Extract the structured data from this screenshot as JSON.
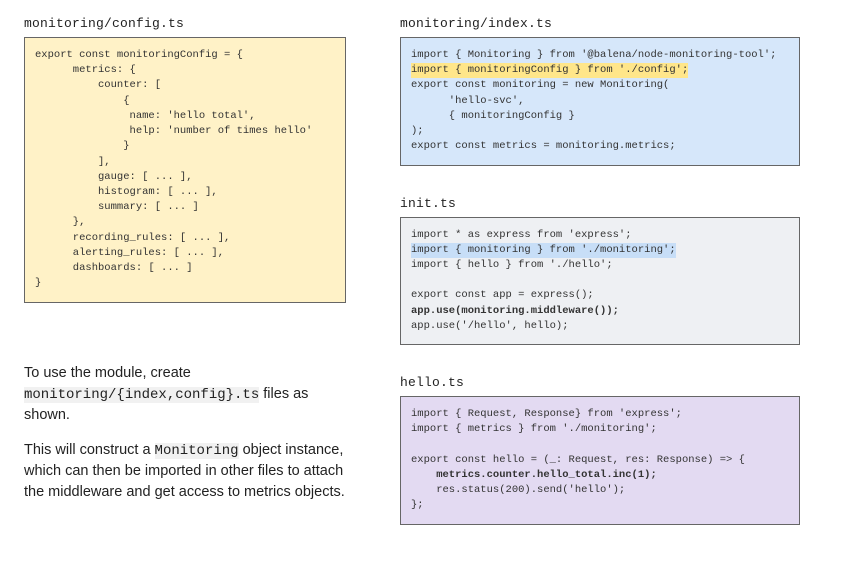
{
  "left": {
    "config_title": "monitoring/config.ts",
    "config_code": "export const monitoringConfig = {\n      metrics: {\n          counter: [\n              {\n               name: 'hello total',\n               help: 'number of times hello'\n              }\n          ],\n          gauge: [ ... ],\n          histogram: [ ... ],\n          summary: [ ... ]\n      },\n      recording_rules: [ ... ],\n      alerting_rules: [ ... ],\n      dashboards: [ ... ]\n}",
    "desc_p1_a": "To use the module, create ",
    "desc_p1_mono": "monitoring/{index,config}.ts",
    "desc_p1_b": " files as shown.",
    "desc_p2_a": "This will construct a ",
    "desc_p2_mono": "Monitoring",
    "desc_p2_b": " object instance, which can then be imported in other files to attach the middleware and get access to metrics objects."
  },
  "right": {
    "index_title": "monitoring/index.ts",
    "index_lines": [
      {
        "text": "import { Monitoring } from '@balena/node-monitoring-tool';"
      },
      {
        "text": "import { monitoringConfig } from './config';",
        "hl": "yellow"
      },
      {
        "text": "export const monitoring = new Monitoring("
      },
      {
        "text": "      'hello-svc',"
      },
      {
        "text": "      { monitoringConfig }"
      },
      {
        "text": ");"
      },
      {
        "text": "export const metrics = monitoring.metrics;"
      }
    ],
    "init_title": "init.ts",
    "init_lines": [
      {
        "text": "import * as express from 'express';"
      },
      {
        "text": "import { monitoring } from './monitoring';",
        "hl": "blue"
      },
      {
        "text": "import { hello } from './hello';"
      },
      {
        "text": ""
      },
      {
        "text": "export const app = express();"
      },
      {
        "text": "app.use(monitoring.middleware());",
        "bold": true
      },
      {
        "text": "app.use('/hello', hello);"
      }
    ],
    "hello_title": "hello.ts",
    "hello_lines": [
      {
        "text": "import { Request, Response} from 'express';"
      },
      {
        "text": "import { metrics } from './monitoring';"
      },
      {
        "text": ""
      },
      {
        "text": "export const hello = (_: Request, res: Response) => {"
      },
      {
        "text": "    metrics.counter.hello_total.inc(1);",
        "bold": true
      },
      {
        "text": "    res.status(200).send('hello');"
      },
      {
        "text": "};"
      }
    ]
  }
}
